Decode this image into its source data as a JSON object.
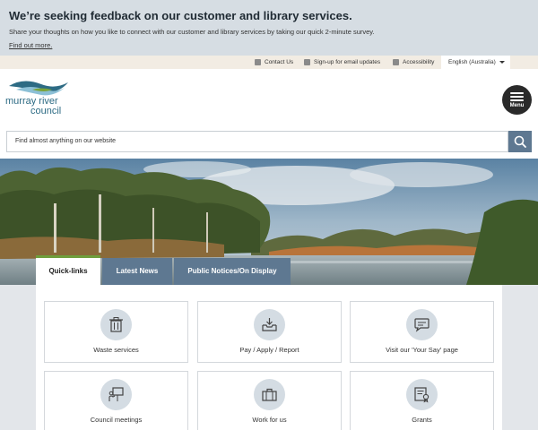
{
  "feedback": {
    "title": "We’re seeking feedback on our customer and library services.",
    "text": "Share your thoughts on how you like to connect with our customer and library services by taking our quick 2-minute survey.",
    "link": "Find out more."
  },
  "utility": {
    "contact": "Contact Us",
    "signup": "Sign-up for email updates",
    "accessibility": "Accessibility",
    "language": "English (Australia)"
  },
  "header": {
    "logo_line1": "murray river",
    "logo_line2": "council",
    "menu_label": "Menu"
  },
  "search": {
    "placeholder": "Find almost anything on our website"
  },
  "tabs": [
    {
      "label": "Quick-links"
    },
    {
      "label": "Latest News"
    },
    {
      "label": "Public Notices/On Display"
    }
  ],
  "tiles": [
    {
      "label": "Waste services",
      "icon": "bin-icon"
    },
    {
      "label": "Pay / Apply / Report",
      "icon": "inbox-download-icon"
    },
    {
      "label": "Visit our 'Your Say' page",
      "icon": "speech-bubble-icon"
    },
    {
      "label": "Council meetings",
      "icon": "presentation-icon"
    },
    {
      "label": "Work for us",
      "icon": "briefcase-icon"
    },
    {
      "label": "Grants",
      "icon": "certificate-icon"
    }
  ],
  "colors": {
    "banner": "#d6dde3",
    "utility_bar": "#f2ece3",
    "tab_inactive": "#5e7891",
    "tab_active_accent": "#6e9e3c",
    "logo": "#2d6b84"
  }
}
